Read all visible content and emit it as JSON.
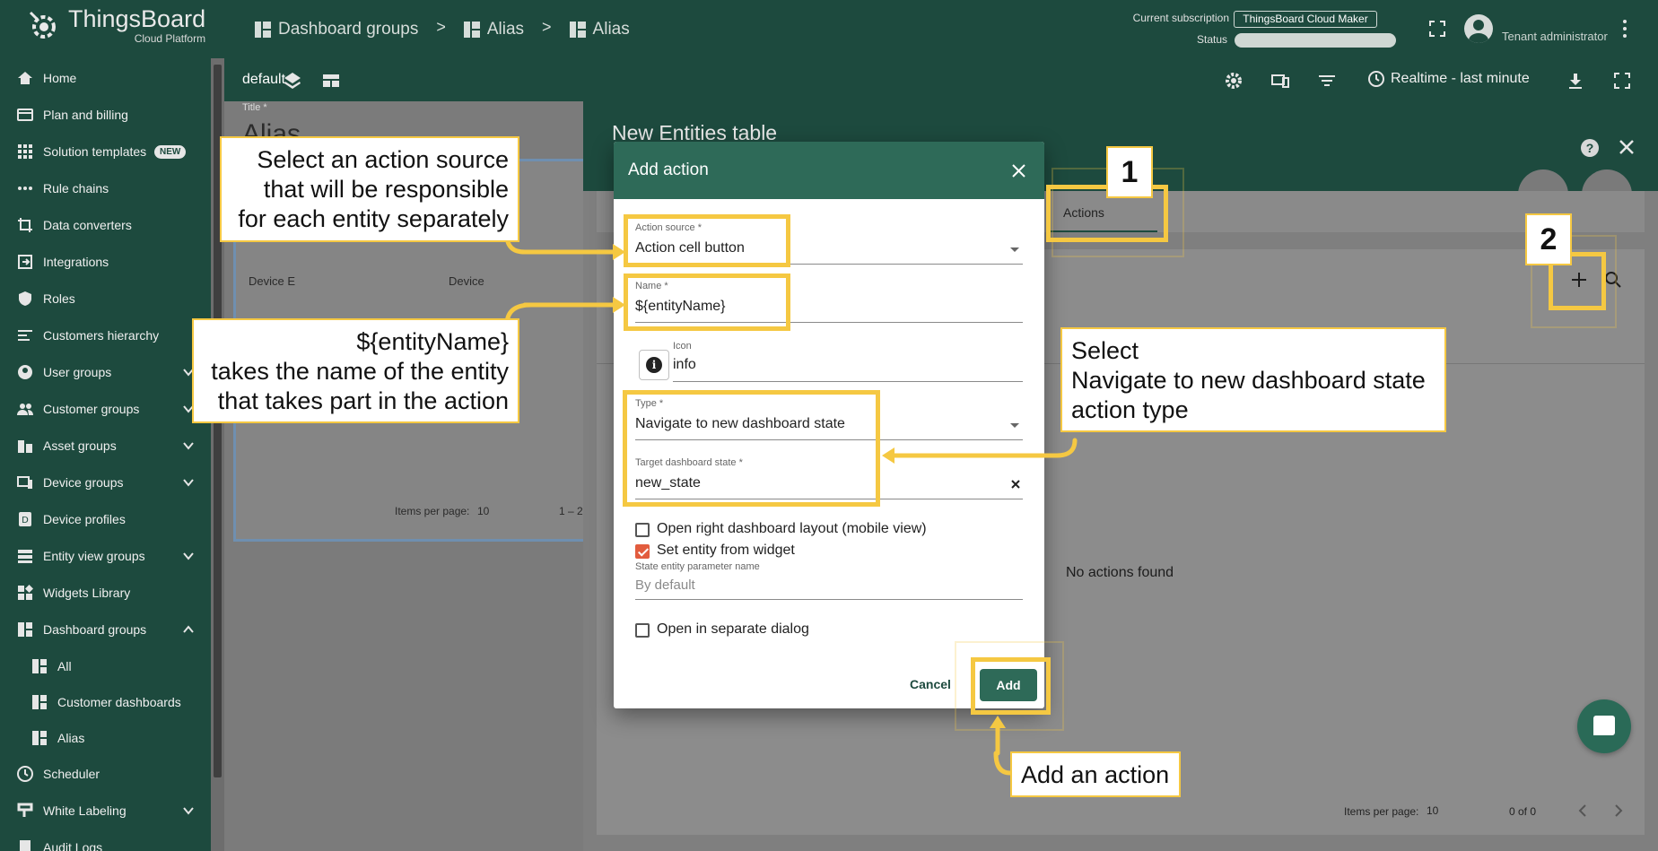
{
  "app": {
    "brand": "ThingsBoard",
    "brand_sub": "Cloud Platform"
  },
  "breadcrumb": [
    "Dashboard groups",
    "Alias",
    "Alias"
  ],
  "subscription": {
    "label": "Current subscription",
    "plan": "ThingsBoard Cloud Maker",
    "status_label": "Status"
  },
  "user": {
    "role": "Tenant administrator"
  },
  "sidebar": {
    "items": [
      {
        "label": "Home",
        "icon": "home-icon"
      },
      {
        "label": "Plan and billing",
        "icon": "card-icon"
      },
      {
        "label": "Solution templates",
        "icon": "apps-icon",
        "badge": "NEW"
      },
      {
        "label": "Rule chains",
        "icon": "rule-chain-icon"
      },
      {
        "label": "Data converters",
        "icon": "converter-icon"
      },
      {
        "label": "Integrations",
        "icon": "integration-icon"
      },
      {
        "label": "Roles",
        "icon": "shield-icon"
      },
      {
        "label": "Customers hierarchy",
        "icon": "hierarchy-icon"
      },
      {
        "label": "User groups",
        "icon": "user-icon",
        "chevron": "down"
      },
      {
        "label": "Customer groups",
        "icon": "group-icon",
        "chevron": "down"
      },
      {
        "label": "Asset groups",
        "icon": "asset-icon",
        "chevron": "down"
      },
      {
        "label": "Device groups",
        "icon": "device-icon",
        "chevron": "down"
      },
      {
        "label": "Device profiles",
        "icon": "profile-icon"
      },
      {
        "label": "Entity view groups",
        "icon": "entity-view-icon",
        "chevron": "down"
      },
      {
        "label": "Widgets Library",
        "icon": "widgets-icon"
      },
      {
        "label": "Dashboard groups",
        "icon": "dashboard-icon",
        "chevron": "up"
      }
    ],
    "sub_items": [
      {
        "label": "All",
        "icon": "dashboard-icon"
      },
      {
        "label": "Customer dashboards",
        "icon": "dashboard-icon"
      },
      {
        "label": "Alias",
        "icon": "dashboard-icon"
      }
    ],
    "tail_items": [
      {
        "label": "Scheduler",
        "icon": "clock-icon"
      },
      {
        "label": "White Labeling",
        "icon": "brush-icon",
        "chevron": "down"
      },
      {
        "label": "Audit Logs",
        "icon": "log-icon"
      }
    ]
  },
  "toolbar": {
    "state": "default",
    "realtime": "Realtime - last minute"
  },
  "background": {
    "title_label": "Title *",
    "title": "Alias",
    "col1": "Device E",
    "col2": "Device",
    "items_per_page": "Items per page:",
    "ipp_value": "10",
    "range": "1 – 2"
  },
  "panel": {
    "title": "New Entities table",
    "tab_actions": "Actions",
    "no_actions": "No actions found",
    "items_per_page": "Items per page:",
    "ipp_value": "10",
    "count": "0 of 0"
  },
  "dialog": {
    "title": "Add action",
    "action_source_label": "Action source *",
    "action_source_value": "Action cell button",
    "name_label": "Name *",
    "name_value": "${entityName}",
    "icon_label": "Icon",
    "icon_value": "info",
    "type_label": "Type *",
    "type_value": "Navigate to new dashboard state",
    "target_state_label": "Target dashboard state *",
    "target_state_value": "new_state",
    "chk_open_right": "Open right dashboard layout (mobile view)",
    "chk_set_entity": "Set entity from widget",
    "state_param_label": "State entity parameter name",
    "state_param_placeholder": "By default",
    "chk_separate_dialog": "Open in separate dialog",
    "cancel": "Cancel",
    "add": "Add",
    "checks": {
      "open_right": false,
      "set_entity": true,
      "separate_dialog": false
    }
  },
  "annotations": {
    "callout_source": "Select an action source\nthat will be responsible\nfor each entity separately",
    "callout_name": "${entityName}\ntakes the name of the entity\nthat takes part in the action",
    "callout_type": "Select\nNavigate to new dashboard state\naction type",
    "callout_add": "Add an action",
    "num1": "1",
    "num2": "2",
    "highlight_color": "#f5c842"
  },
  "colors": {
    "primary": "#1d4a3e",
    "dialog_header": "#2e6a58",
    "checkbox_on": "#e25c3e"
  }
}
